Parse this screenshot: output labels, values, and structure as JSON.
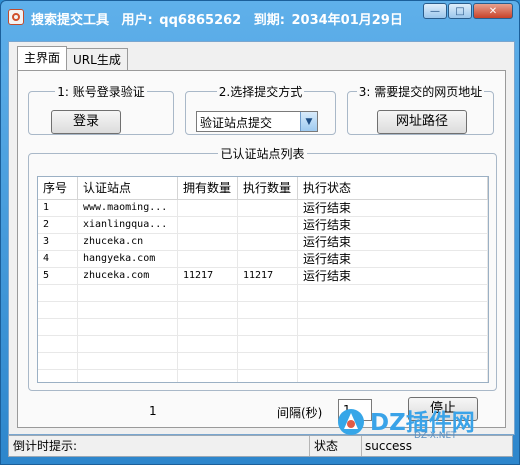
{
  "window": {
    "app_name": "搜索提交工具",
    "user_label": "用户:",
    "user_value": "qq6865262",
    "expire_label": "到期:",
    "expire_value": "2034年01月29日",
    "min_symbol": "—",
    "max_symbol": "□",
    "close_symbol": "✕"
  },
  "tabs": [
    {
      "label": "主界面",
      "active": true
    },
    {
      "label": "URL生成",
      "active": false
    }
  ],
  "group1": {
    "legend": "1: 账号登录验证",
    "button": "登录"
  },
  "group2": {
    "legend": "2.选择提交方式",
    "select_value": "验证站点提交",
    "arrow": "▼"
  },
  "group3": {
    "legend": "3: 需要提交的网页地址",
    "button": "网址路径"
  },
  "site_group": {
    "legend": "已认证站点列表"
  },
  "table": {
    "headers": [
      "序号",
      "认证站点",
      "拥有数量",
      "执行数量",
      "执行状态"
    ],
    "rows": [
      [
        "1",
        "www.maoming...",
        "",
        "",
        "运行结束"
      ],
      [
        "2",
        "xianlingqua...",
        "",
        "",
        "运行结束"
      ],
      [
        "3",
        "zhuceka.cn",
        "",
        "",
        "运行结束"
      ],
      [
        "4",
        "hangyeka.com",
        "",
        "",
        "运行结束"
      ],
      [
        "5",
        "zhuceka.com",
        "11217",
        "11217",
        "运行结束"
      ]
    ]
  },
  "bottom": {
    "count": "1",
    "interval_label": "间隔(秒)",
    "interval_value": "1",
    "stop_button": "停止"
  },
  "statusbar": {
    "countdown_label": "倒计时提示:",
    "status_label": "状态",
    "status_value": "success"
  },
  "watermark": {
    "text": "DZ插件网",
    "sub": "DZ-X.NET"
  }
}
